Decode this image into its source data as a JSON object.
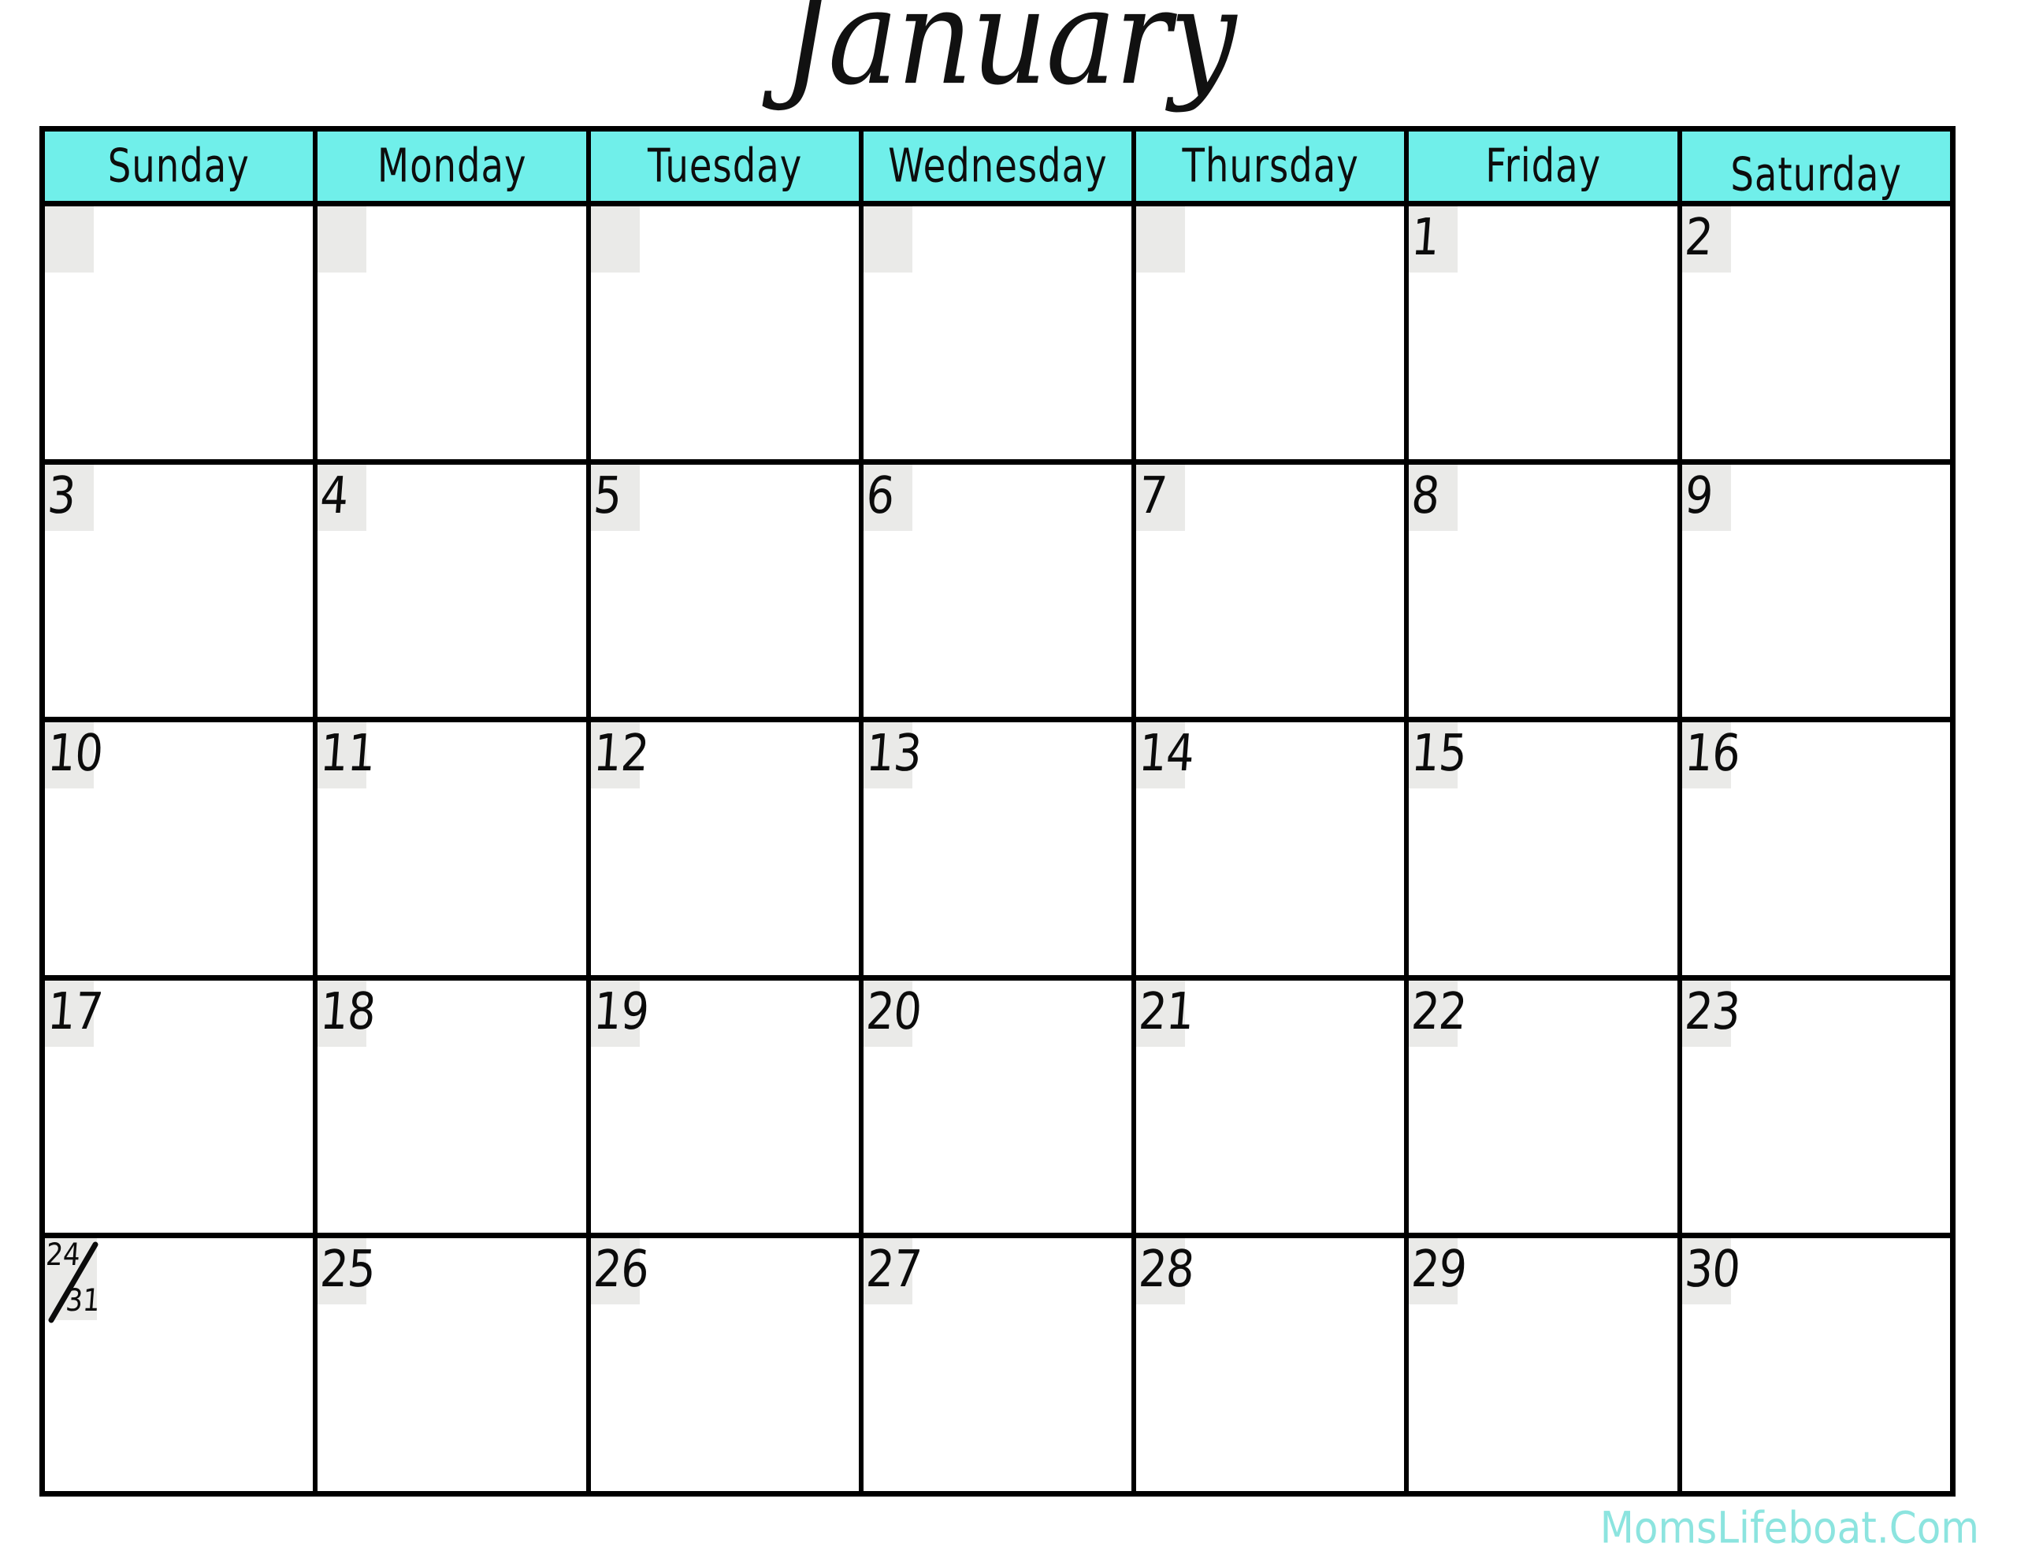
{
  "title": "January",
  "colors": {
    "header_bg": "#70efea",
    "date_box_bg": "#eaeae8",
    "grid_line": "#000000",
    "text": "#0b0b0b",
    "watermark": "#8ce4df",
    "page_bg": "#ffffff"
  },
  "weekdays": [
    {
      "label": "Sunday"
    },
    {
      "label": "Monday"
    },
    {
      "label": "Tuesday"
    },
    {
      "label": "Wednesday"
    },
    {
      "label": "Thursday"
    },
    {
      "label": "Friday"
    },
    {
      "label": "Saturday"
    }
  ],
  "weeks": [
    {
      "days": [
        {
          "number": ""
        },
        {
          "number": ""
        },
        {
          "number": ""
        },
        {
          "number": ""
        },
        {
          "number": ""
        },
        {
          "number": "1"
        },
        {
          "number": "2"
        }
      ]
    },
    {
      "days": [
        {
          "number": "3"
        },
        {
          "number": "4"
        },
        {
          "number": "5"
        },
        {
          "number": "6"
        },
        {
          "number": "7"
        },
        {
          "number": "8"
        },
        {
          "number": "9"
        }
      ]
    },
    {
      "days": [
        {
          "number": "10"
        },
        {
          "number": "11"
        },
        {
          "number": "12"
        },
        {
          "number": "13"
        },
        {
          "number": "14"
        },
        {
          "number": "15"
        },
        {
          "number": "16"
        }
      ]
    },
    {
      "days": [
        {
          "number": "17"
        },
        {
          "number": "18"
        },
        {
          "number": "19"
        },
        {
          "number": "20"
        },
        {
          "number": "21"
        },
        {
          "number": "22"
        },
        {
          "number": "23"
        }
      ]
    },
    {
      "days": [
        {
          "number": "",
          "split_top": "24",
          "split_bottom": "31"
        },
        {
          "number": "25"
        },
        {
          "number": "26"
        },
        {
          "number": "27"
        },
        {
          "number": "28"
        },
        {
          "number": "29"
        },
        {
          "number": "30"
        }
      ]
    }
  ],
  "footer": {
    "watermark": "MomsLifeboat.Com"
  }
}
